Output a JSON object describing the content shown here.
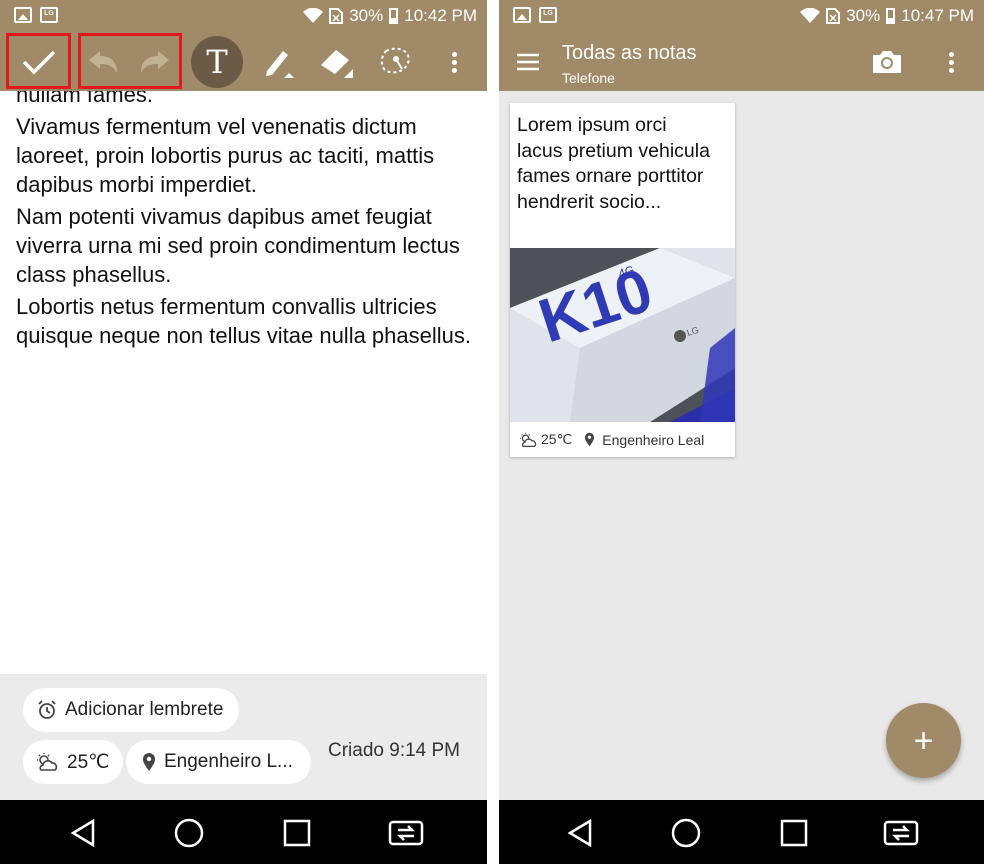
{
  "left_screen": {
    "status_bar": {
      "battery": "30%",
      "time": "10:42 PM"
    },
    "toolbar": {
      "text_tool_glyph": "T"
    },
    "note": {
      "paragraphs": [
        "nullam fames.",
        "Vivamus fermentum vel venenatis dictum laoreet, proin lobortis purus ac taciti, mattis dapibus morbi imperdiet.",
        "Nam potenti vivamus dapibus amet feugiat viverra urna mi sed proin condimentum lectus class phasellus.",
        "Lobortis netus fermentum convallis ultricies quisque neque non tellus vitae nulla phasellus."
      ]
    },
    "bottom": {
      "reminder_label": "Adicionar lembrete",
      "weather_temp": "25℃",
      "location": "Engenheiro L...",
      "created": "Criado 9:14 PM"
    }
  },
  "right_screen": {
    "status_bar": {
      "battery": "30%",
      "time": "10:47 PM"
    },
    "header": {
      "title": "Todas as notas",
      "subtitle": "Telefone"
    },
    "card": {
      "text": "Lorem ipsum orci lacus pretium vehicula fames ornare porttitor hendrerit socio...",
      "weather_temp": "25℃",
      "location": "Engenheiro Leal",
      "photo_caption": {
        "brand": "K10",
        "sub": "4G",
        "maker": "LG"
      }
    },
    "fab_label": "+"
  },
  "colors": {
    "bar_brown": "#a08a68",
    "highlight_red": "#e2191c",
    "text_circle": "#6b5a45",
    "list_bg": "#e9e9e9"
  },
  "icons": {
    "left_toolbar": [
      "check-icon",
      "undo-icon",
      "redo-icon",
      "text-icon",
      "pen-icon",
      "eraser-icon",
      "lasso-icon",
      "more-vert-icon"
    ],
    "right_toolbar": [
      "menu-icon",
      "camera-icon",
      "more-vert-icon"
    ],
    "nav": [
      "back-icon",
      "home-icon",
      "recents-icon",
      "switch-icon"
    ]
  }
}
